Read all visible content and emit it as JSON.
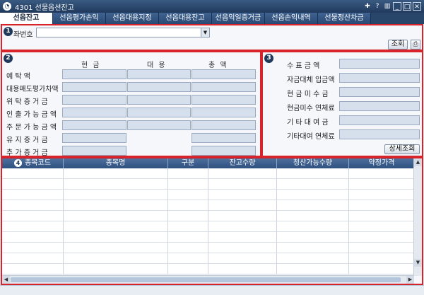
{
  "window": {
    "title": "4301 선물옵션잔고",
    "controls": [
      "✚",
      "?",
      "▥",
      "_",
      "□",
      "✕"
    ]
  },
  "tabs": [
    "선옵잔고",
    "선옵평가손익",
    "선옵대용지정",
    "선옵대용잔고",
    "선옵익일증거금",
    "선옵손익내역",
    "선물정산차금"
  ],
  "section1": {
    "badge": "1",
    "account_label": "좌번호",
    "account_value": "",
    "query_button": "조회",
    "print_icon": "printer-icon"
  },
  "section2": {
    "badge": "2",
    "columns": [
      "현 금",
      "대 용",
      "총 액"
    ],
    "rows": [
      "예 탁 액",
      "대용매도평가차액",
      "위 탁 증 거 금",
      "인 출 가 능 금 액",
      "주 문 가 능 금 액",
      "유 지 증 거 금",
      "추 가 증 거 금"
    ]
  },
  "section3": {
    "badge": "3",
    "rows": [
      "수 표 금 액",
      "자금대체 입금액",
      "현 금 미 수 금",
      "현금미수 연체료",
      "기 타 대 여 금",
      "기타대여 연체료"
    ],
    "detail_button": "상세조회"
  },
  "section4": {
    "badge": "4",
    "columns": [
      "종목코드",
      "종목명",
      "구분",
      "잔고수량",
      "청산가능수량",
      "약정가격"
    ]
  },
  "colors": {
    "accent": "#d9232b",
    "titlebar": "#203a5c",
    "grid_header": "#3a5e8e",
    "field": "#d6e0ec"
  }
}
